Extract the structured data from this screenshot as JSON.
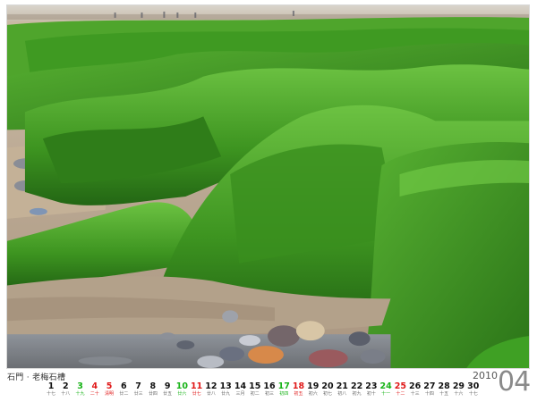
{
  "caption": "石門 ‧ 老梅石槽",
  "year": "2010",
  "month": "04",
  "days": [
    {
      "num": "1",
      "lunar": "十七",
      "tone": "normal"
    },
    {
      "num": "2",
      "lunar": "十八",
      "tone": "normal"
    },
    {
      "num": "3",
      "lunar": "十九",
      "tone": "green"
    },
    {
      "num": "4",
      "lunar": "二十",
      "tone": "red"
    },
    {
      "num": "5",
      "lunar": "清明",
      "tone": "red"
    },
    {
      "num": "6",
      "lunar": "廿二",
      "tone": "normal"
    },
    {
      "num": "7",
      "lunar": "廿三",
      "tone": "normal"
    },
    {
      "num": "8",
      "lunar": "廿四",
      "tone": "normal"
    },
    {
      "num": "9",
      "lunar": "廿五",
      "tone": "normal"
    },
    {
      "num": "10",
      "lunar": "廿六",
      "tone": "green"
    },
    {
      "num": "11",
      "lunar": "廿七",
      "tone": "red"
    },
    {
      "num": "12",
      "lunar": "廿八",
      "tone": "normal"
    },
    {
      "num": "13",
      "lunar": "廿九",
      "tone": "normal"
    },
    {
      "num": "14",
      "lunar": "三月",
      "tone": "normal"
    },
    {
      "num": "15",
      "lunar": "初二",
      "tone": "normal"
    },
    {
      "num": "16",
      "lunar": "初三",
      "tone": "normal"
    },
    {
      "num": "17",
      "lunar": "初四",
      "tone": "green"
    },
    {
      "num": "18",
      "lunar": "初五",
      "tone": "red"
    },
    {
      "num": "19",
      "lunar": "初六",
      "tone": "normal"
    },
    {
      "num": "20",
      "lunar": "初七",
      "tone": "normal"
    },
    {
      "num": "21",
      "lunar": "初八",
      "tone": "normal"
    },
    {
      "num": "22",
      "lunar": "初九",
      "tone": "normal"
    },
    {
      "num": "23",
      "lunar": "初十",
      "tone": "normal"
    },
    {
      "num": "24",
      "lunar": "十一",
      "tone": "green"
    },
    {
      "num": "25",
      "lunar": "十二",
      "tone": "red"
    },
    {
      "num": "26",
      "lunar": "十三",
      "tone": "normal"
    },
    {
      "num": "27",
      "lunar": "十四",
      "tone": "normal"
    },
    {
      "num": "28",
      "lunar": "十五",
      "tone": "normal"
    },
    {
      "num": "29",
      "lunar": "十六",
      "tone": "normal"
    },
    {
      "num": "30",
      "lunar": "十七",
      "tone": "normal"
    }
  ],
  "colors": {
    "sunday": "#e01818",
    "saturday": "#17b317",
    "moss": "#3f9b1f",
    "sand": "#b6a48c"
  }
}
